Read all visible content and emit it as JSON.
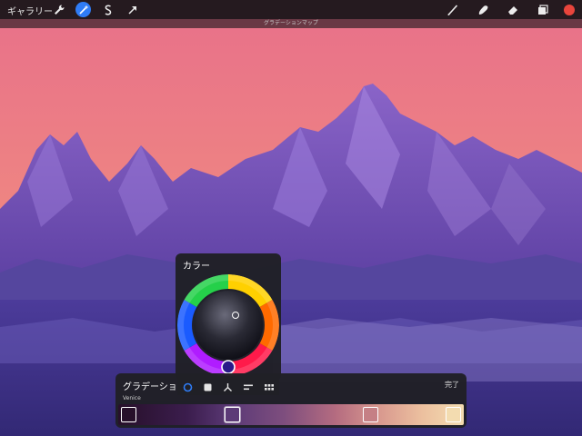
{
  "toolbar": {
    "gallery_label": "ギャラリー",
    "left_tools": [
      "wrench-icon",
      "magic-wand-icon",
      "selection-icon",
      "transform-arrow-icon"
    ],
    "right_tools": [
      "brush-icon",
      "smudge-icon",
      "eraser-icon",
      "layers-icon",
      "color-swatch-icon"
    ],
    "active_tool": "magic-wand-icon",
    "active_color": "#e8453c",
    "accent": "#2f7cf6"
  },
  "subtitle": "グラデーションマップ",
  "color_popup": {
    "title": "カラー"
  },
  "gradient_panel": {
    "title": "グラデーショ",
    "done_label": "完了",
    "preset_name": "Venice",
    "mode_tabs": [
      "disc-mode-icon",
      "classic-mode-icon",
      "harmony-mode-icon",
      "value-mode-icon",
      "palettes-mode-icon"
    ],
    "active_mode": "disc-mode-icon",
    "stops": [
      {
        "position": 0.03,
        "color": "#27102a"
      },
      {
        "position": 0.33,
        "color": "#5c3a77"
      },
      {
        "position": 0.73,
        "color": "#c58085"
      },
      {
        "position": 0.97,
        "color": "#f3dcb0"
      }
    ],
    "selected_stop": 1
  }
}
